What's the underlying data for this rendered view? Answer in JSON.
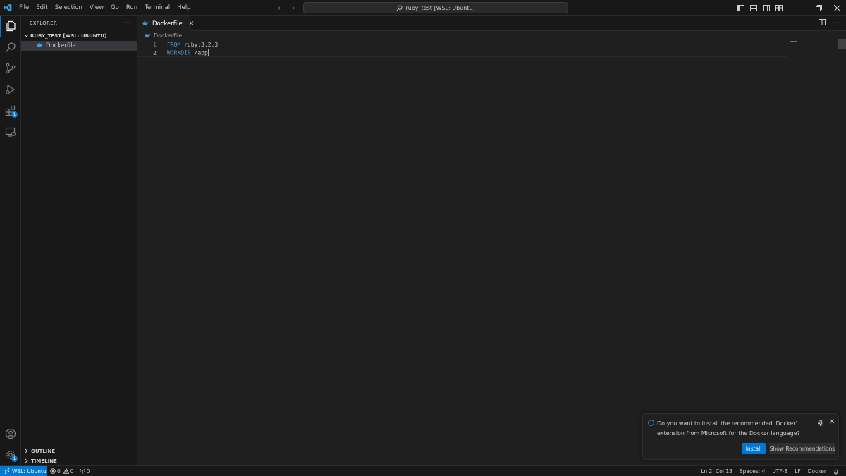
{
  "titlebar": {
    "menu": [
      "File",
      "Edit",
      "Selection",
      "View",
      "Go",
      "Run",
      "Terminal",
      "Help"
    ],
    "command_center": "ruby_test [WSL: Ubuntu]",
    "accent": "#0078d4"
  },
  "activitybar": {
    "extensions_badge": "1",
    "settings_badge": "1"
  },
  "sidebar": {
    "title": "EXPLORER",
    "folder": "RUBY_TEST [WSL: UBUNTU]",
    "files": [
      "Dockerfile"
    ],
    "outline": "OUTLINE",
    "timeline": "TIMELINE"
  },
  "editor": {
    "tab_label": "Dockerfile",
    "breadcrumb": "Dockerfile",
    "lines": [
      {
        "num": "1",
        "keyword": "FROM",
        "text": " ruby:3.2.3"
      },
      {
        "num": "2",
        "keyword": "WORKDIR",
        "text": " /app"
      }
    ]
  },
  "notification": {
    "message": "Do you want to install the recommended 'Docker' extension from Microsoft for the Docker language?",
    "install": "Install",
    "show_recommendations": "Show Recommendations"
  },
  "statusbar": {
    "remote": "WSL: Ubuntu",
    "errors": "0",
    "warnings": "0",
    "ports": "0",
    "position": "Ln 2, Col 13",
    "spaces": "Spaces: 4",
    "encoding": "UTF-8",
    "eol": "LF",
    "language": "Docker"
  }
}
